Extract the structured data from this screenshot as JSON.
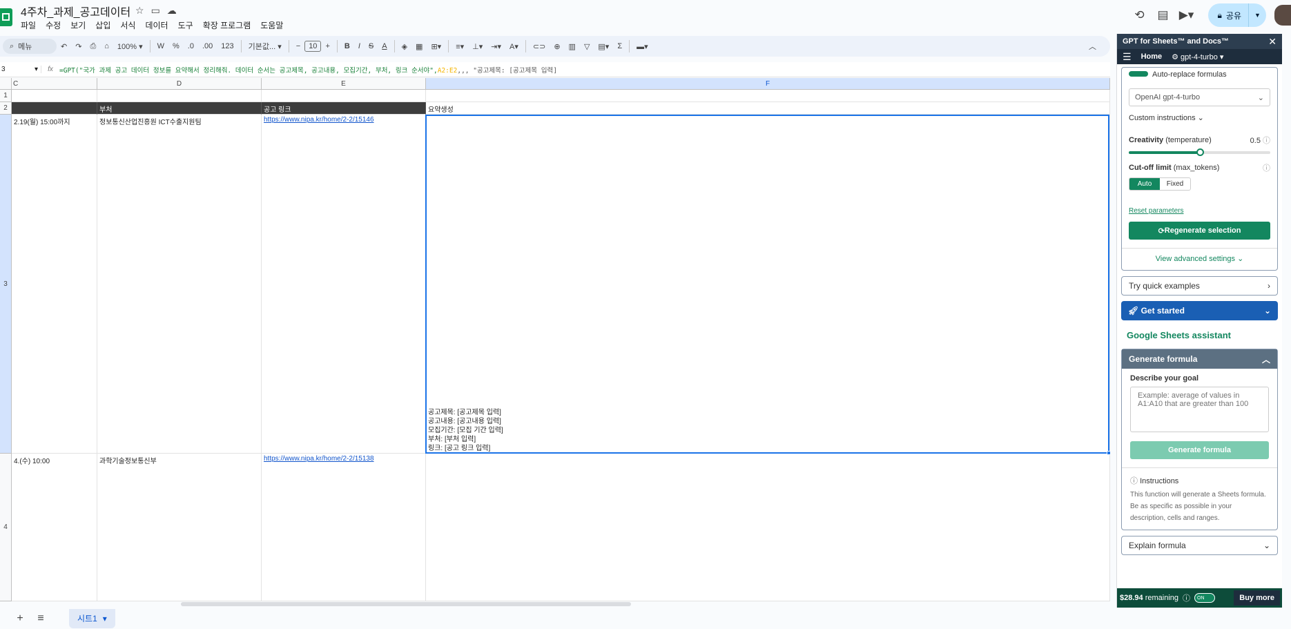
{
  "doc": {
    "title": "4주차_과제_공고데이터",
    "menus": [
      "파일",
      "수정",
      "보기",
      "삽입",
      "서식",
      "데이터",
      "도구",
      "확장 프로그램",
      "도움말"
    ]
  },
  "share_label": "공유",
  "toolbar": {
    "search": "메뉴",
    "zoom": "100%",
    "currency": "W",
    "percent": "%",
    "dec_less": ".0",
    "dec_more": ".00",
    "num_format": "123",
    "font": "기본값...",
    "font_size": "10"
  },
  "formula_bar": {
    "name_box": "3",
    "formula_prefix": "=GPT(\"국가 과제 공고 데이터 정보를 요약해서 정리해줘. 데이터 순서는 공고제목, 공고내용, 모집기간, 부처, 링크 순서야\",",
    "formula_ref": "A2:E2",
    "formula_suffix": ",,, \"공고제목: [공고제목 입력]"
  },
  "columns": [
    "C",
    "D",
    "E",
    "F"
  ],
  "rows": [
    "1",
    "2",
    "3",
    "4"
  ],
  "header_row": {
    "c": "",
    "d": "부처",
    "e": "공고 링크",
    "f": "요약생성"
  },
  "data_rows": [
    {
      "c": "2.19(월) 15:00까지",
      "d": "정보통신산업진흥원 ICT수출지원팀",
      "e": "https://www.nipa.kr/home/2-2/15146"
    },
    {
      "c": "4.(수) 10:00",
      "d": "과학기술정보통신부",
      "e": "https://www.nipa.kr/home/2-2/15138"
    }
  ],
  "summary_lines": [
    "공고제목: [공고제목 입력]",
    "공고내용: [공고내용 입력]",
    "모집기간: [모집 기간 입력]",
    "부처: [부처 입력]",
    "링크: [공고 링크 입력]"
  ],
  "sheet_tab": "시트1",
  "panel": {
    "title": "GPT for Sheets™ and Docs™",
    "nav_home": "Home",
    "nav_model": "gpt-4-turbo",
    "auto_replace": "Auto-replace formulas",
    "model_select": "OpenAI gpt-4-turbo",
    "custom_instructions": "Custom instructions",
    "creativity_label": "Creativity",
    "creativity_param": "(temperature)",
    "creativity_value": "0.5",
    "creativity_fraction": 0.5,
    "cutoff_label": "Cut-off limit",
    "cutoff_param": "(max_tokens)",
    "cutoff_auto": "Auto",
    "cutoff_fixed": "Fixed",
    "reset": "Reset parameters",
    "regenerate": "Regenerate selection",
    "advanced": "View advanced settings",
    "quick_examples": "Try quick examples",
    "get_started": "Get started",
    "assistant_title": "Google Sheets assistant",
    "generate_formula": "Generate formula",
    "describe_goal": "Describe your goal",
    "goal_placeholder": "Example: average of values in A1:A10 that are greater than 100",
    "generate_btn": "Generate formula",
    "instructions_title": "Instructions",
    "instructions_text": "This function will generate a Sheets formula. Be as specific as possible in your description, cells and ranges.",
    "explain_formula": "Explain formula",
    "remaining": "$28.94",
    "remaining_label": "remaining",
    "toggle": "ON",
    "buy_more": "Buy more"
  }
}
